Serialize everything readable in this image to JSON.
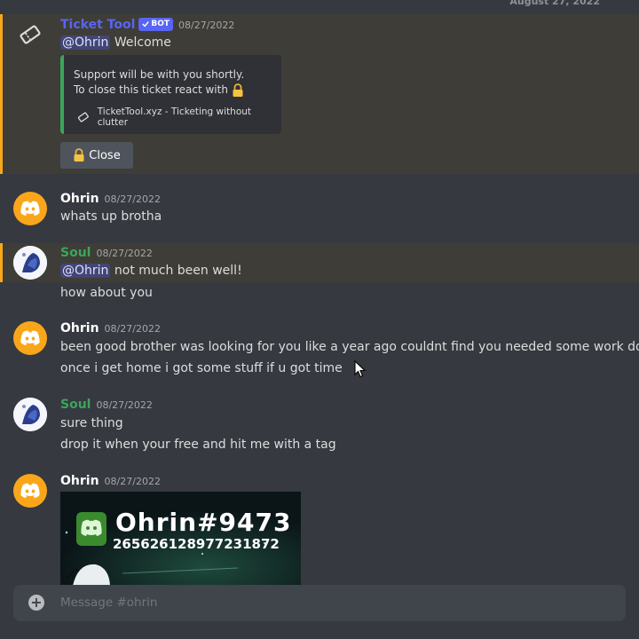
{
  "date_divider": "August 27, 2022",
  "messages": {
    "bot": {
      "author": "Ticket Tool",
      "badge": "BOT",
      "timestamp": "08/27/2022",
      "mention": "@Ohrin",
      "text": "Welcome",
      "embed_line1": "Support will be with you shortly.",
      "embed_line2": "To close this ticket react with",
      "embed_footer": "TicketTool.xyz - Ticketing without clutter",
      "button_label": "Close"
    },
    "m1": {
      "author": "Ohrin",
      "timestamp": "08/27/2022",
      "line1": "whats up brotha"
    },
    "m2": {
      "author": "Soul",
      "timestamp": "08/27/2022",
      "mention": "@Ohrin",
      "line1": "not much been well!",
      "line2": "how about you"
    },
    "m3": {
      "author": "Ohrin",
      "timestamp": "08/27/2022",
      "line1": "been good brother was looking for you like a year ago couldnt find you needed some work done",
      "line2": "once i get home i got some stuff if u got time"
    },
    "m4": {
      "author": "Soul",
      "timestamp": "08/27/2022",
      "line1": "sure thing",
      "line2": "drop it when your free and hit me with a tag"
    },
    "m5": {
      "author": "Ohrin",
      "timestamp": "08/27/2022",
      "image_title": "Ohrin#9473",
      "image_id": "265626128977231872"
    }
  },
  "input": {
    "placeholder": "Message #ohrin"
  },
  "colors": {
    "background": "#36393f",
    "mention_highlight": "#3f3d37",
    "mention_bar": "#faa81a",
    "embed_bar": "#3ba55c",
    "soul_name": "#3ba55c",
    "bot_name": "#5865f2",
    "avatar_ohrin": "#faa61a"
  },
  "icons": {
    "bot_avatar": "ticket-icon",
    "ohrin_avatar": "discord-logo-icon",
    "button": "lock-icon",
    "input": "plus-icon"
  }
}
